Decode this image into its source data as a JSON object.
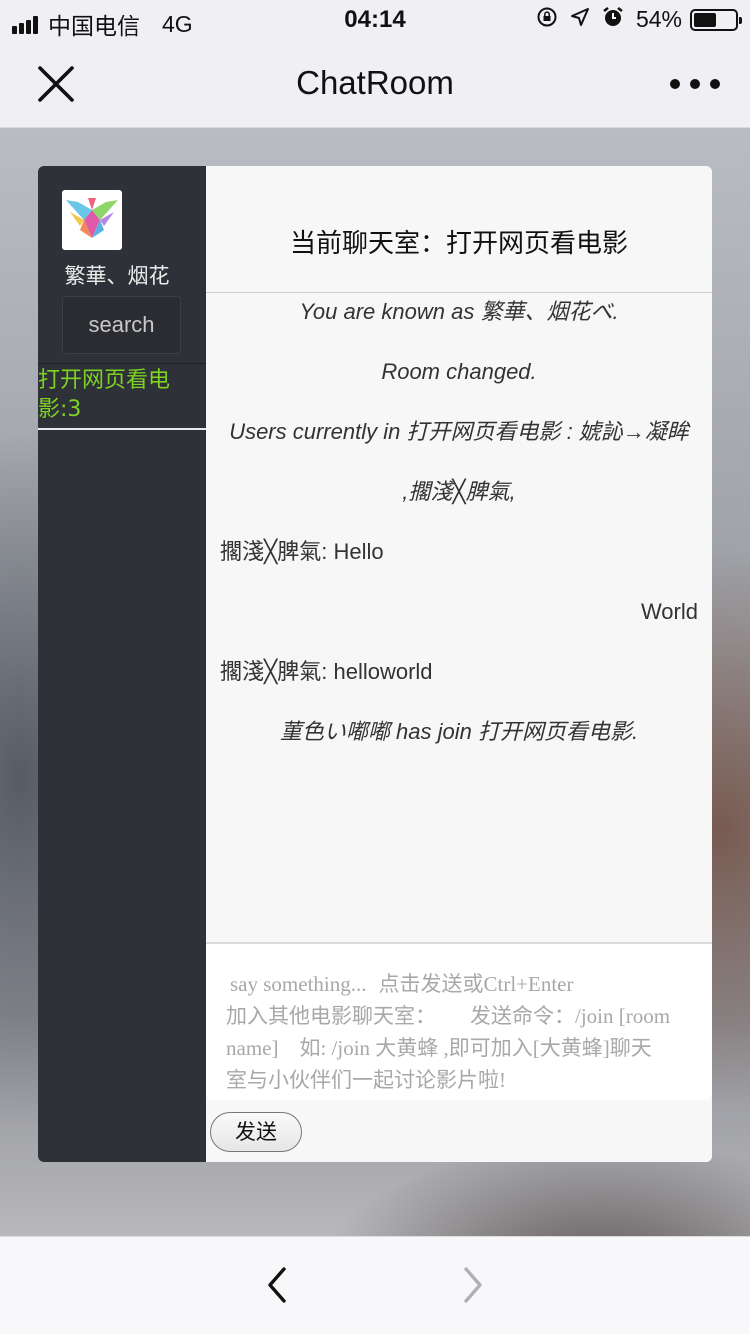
{
  "status_bar": {
    "carrier": "中国电信",
    "network": "4G",
    "time": "04:14",
    "battery_percent": "54%",
    "battery_level": 0.54,
    "icons": [
      "lock-rotation-icon",
      "location-arrow-icon",
      "alarm-icon"
    ]
  },
  "nav": {
    "title": "ChatRoom",
    "close_icon": "close-icon",
    "more_icon": "more-icon"
  },
  "sidebar": {
    "username": "繁華、烟花",
    "search_placeholder": "search",
    "rooms": [
      {
        "label": "打开网页看电影:3",
        "color": "#7dd321"
      }
    ]
  },
  "room": {
    "header": "当前聊天室：打开网页看电影"
  },
  "messages": [
    {
      "type": "system",
      "text": "You are known as 繁華、烟花べ."
    },
    {
      "type": "system",
      "text": "Room changed."
    },
    {
      "type": "system",
      "text": "Users currently in 打开网页看电影 : 婋訫→凝眸"
    },
    {
      "type": "system",
      "text": ",擱淺╳脾氣,"
    },
    {
      "type": "user",
      "text": "擱淺╳脾氣: Hello"
    },
    {
      "type": "self",
      "text": "World"
    },
    {
      "type": "user",
      "text": "擱淺╳脾氣: helloworld"
    },
    {
      "type": "system",
      "text": "菫色い嘟嘟 has join 打开网页看电影."
    }
  ],
  "compose": {
    "hint_line1a": "say something...",
    "hint_line1b": "点击发送或Ctrl+Enter",
    "hint_line2a": "加入其他电影聊天室：",
    "hint_line2b": "发送命令：/join [room",
    "hint_line3": "name]　如: /join 大黄蜂 ,即可加入[大黄蜂]聊天",
    "hint_line4": "室与小伙伴们一起讨论影片啦!"
  },
  "send_button": "发送",
  "colors": {
    "sidebar_bg": "#2f3138",
    "active_room": "#7dd321",
    "panel_bg": "#f7f7f7"
  }
}
